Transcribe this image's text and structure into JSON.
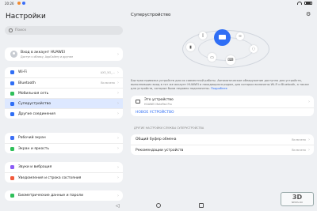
{
  "status_bar": {
    "time": "20:26",
    "status_icons": [
      {
        "name": "orange-notification-icon",
        "color": "#f28a2e"
      },
      {
        "name": "blue-notification-icon",
        "color": "#3b6ef5"
      }
    ],
    "right_icons": [
      "wifi-icon",
      "battery-icon"
    ]
  },
  "left_pane": {
    "title": "Настройки",
    "search_placeholder": "Поиск",
    "account": {
      "title": "Вход в аккаунт HUAWEI",
      "subtitle": "Доступ к облаку, AppGallery и другим"
    },
    "group1": [
      {
        "label": "Wi-Fi",
        "value": "AX3_5G_...",
        "icon": "wifi-icon",
        "icon_color": "#2f6ef5"
      },
      {
        "label": "Bluetooth",
        "value": "Включено",
        "icon": "bluetooth-icon",
        "icon_color": "#2f6ef5"
      },
      {
        "label": "Мобильная сеть",
        "value": "",
        "icon": "mobile-network-icon",
        "icon_color": "#2fbf5a"
      },
      {
        "label": "Суперустройство",
        "value": "",
        "icon": "super-device-icon",
        "icon_color": "#2f6ef5",
        "selected": true
      },
      {
        "label": "Другие соединения",
        "value": "",
        "icon": "other-connections-icon",
        "icon_color": "#2f6ef5"
      }
    ],
    "group2": [
      {
        "label": "Рабочий экран",
        "value": "",
        "icon": "home-screen-icon",
        "icon_color": "#3b6ef5"
      },
      {
        "label": "Экран и яркость",
        "value": "",
        "icon": "display-icon",
        "icon_color": "#2fbf5a"
      }
    ],
    "group3": [
      {
        "label": "Звуки и вибрация",
        "value": "",
        "icon": "sound-icon",
        "icon_color": "#8a5cf5"
      },
      {
        "label": "Уведомления и строка состояния",
        "value": "",
        "icon": "notifications-icon",
        "icon_color": "#f25a3c"
      }
    ],
    "group4": [
      {
        "label": "Биометрические данные и пароли",
        "value": "",
        "icon": "biometrics-icon",
        "icon_color": "#2fbf5a"
      }
    ]
  },
  "right_pane": {
    "title": "Суперустройство",
    "description": "Быстрая привязка устройств для их совместной работы. Автоматическое обнаружение доступно для устройств, выполнивших вход в тот же аккаунт HUAWEI и находящихся рядом, для которых включены Wi-Fi и Bluetooth, а также для устройств, которые были недавно подключены.",
    "description_link": "Подробнее",
    "this_device": {
      "title": "Это устройство",
      "subtitle": "HUAWEI MatePad Pro"
    },
    "new_device": "НОВОЕ УСТРОЙСТВО",
    "other_section_title": "ДРУГИЕ НАСТРОЙКИ СЛУЖБЫ СУПЕРУСТРОЙСТВА",
    "settings": [
      {
        "label": "Общий буфер обмена",
        "value": "Включено"
      },
      {
        "label": "Рекомендации устройств",
        "value": "Включено"
      }
    ]
  },
  "watermark": {
    "line1": "3D",
    "line2": "NEWS.RU"
  }
}
